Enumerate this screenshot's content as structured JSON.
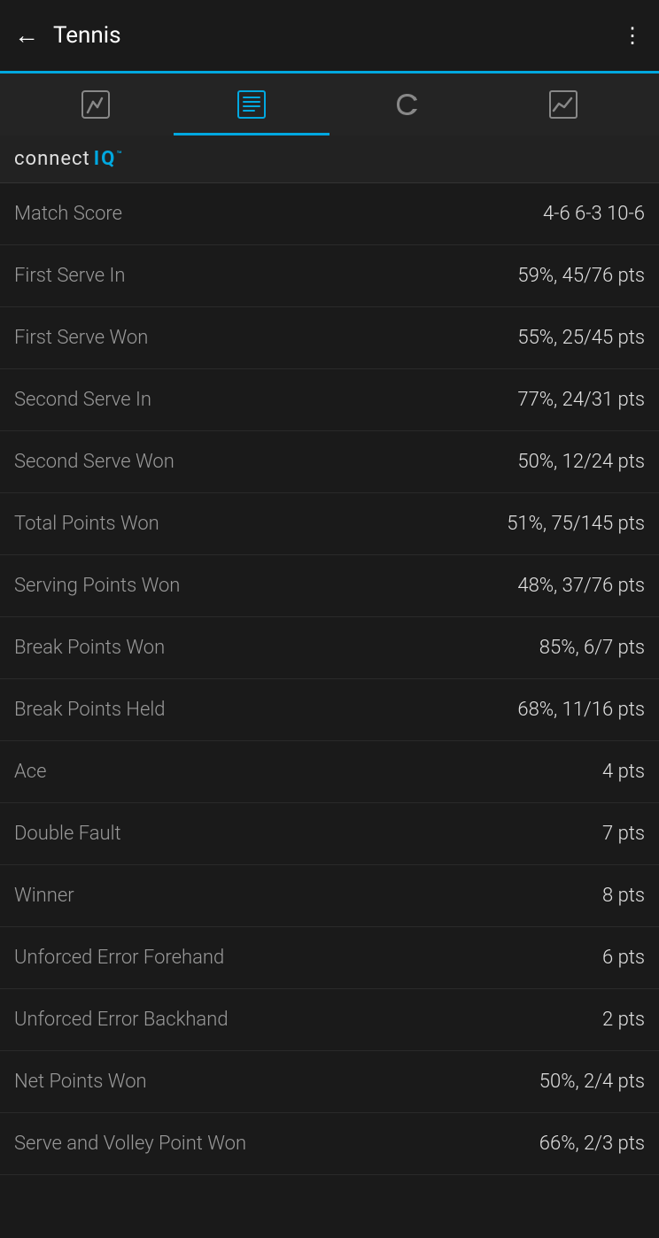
{
  "header": {
    "back_label": "←",
    "title": "Tennis",
    "menu_icon": "⋮"
  },
  "tabs": [
    {
      "id": "activity",
      "label": "Activity",
      "active": false
    },
    {
      "id": "stats",
      "label": "Stats",
      "active": true
    },
    {
      "id": "laps",
      "label": "Laps",
      "active": false
    },
    {
      "id": "charts",
      "label": "Charts",
      "active": false
    }
  ],
  "brand": {
    "connect": "connect",
    "iq": "IQ",
    "tm": "™"
  },
  "stats": [
    {
      "label": "Match Score",
      "value": "4-6 6-3 10-6"
    },
    {
      "label": "First Serve In",
      "value": "59%, 45/76 pts"
    },
    {
      "label": "First Serve Won",
      "value": "55%, 25/45 pts"
    },
    {
      "label": "Second Serve In",
      "value": "77%, 24/31 pts"
    },
    {
      "label": "Second Serve Won",
      "value": "50%, 12/24 pts"
    },
    {
      "label": "Total Points Won",
      "value": "51%, 75/145 pts"
    },
    {
      "label": "Serving Points Won",
      "value": "48%, 37/76 pts"
    },
    {
      "label": "Break Points Won",
      "value": "85%, 6/7 pts"
    },
    {
      "label": "Break Points Held",
      "value": "68%, 11/16 pts"
    },
    {
      "label": "Ace",
      "value": "4 pts"
    },
    {
      "label": "Double Fault",
      "value": "7 pts"
    },
    {
      "label": "Winner",
      "value": "8 pts"
    },
    {
      "label": "Unforced Error Forehand",
      "value": "6 pts"
    },
    {
      "label": "Unforced Error Backhand",
      "value": "2 pts"
    },
    {
      "label": "Net Points Won",
      "value": "50%, 2/4 pts"
    },
    {
      "label": "Serve and Volley Point Won",
      "value": "66%, 2/3 pts"
    }
  ],
  "colors": {
    "accent": "#00a8e0",
    "background": "#1a1a1a",
    "tab_bg": "#242424",
    "text_primary": "#e0e0e0",
    "text_secondary": "#9a9a9a",
    "border": "#2a2a2a"
  }
}
